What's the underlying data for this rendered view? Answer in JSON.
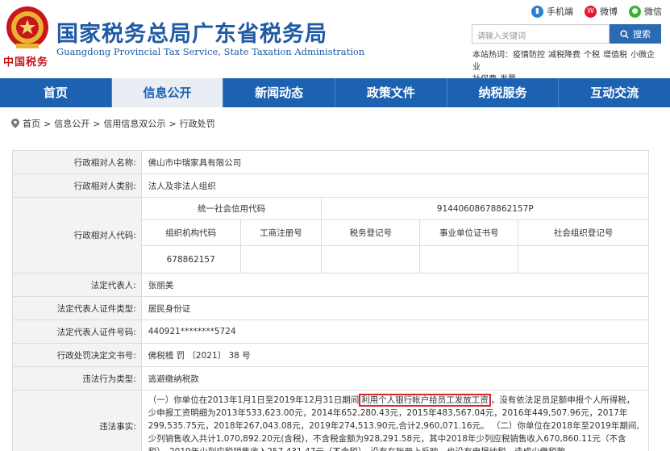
{
  "header": {
    "title": "国家税务总局广东省税务局",
    "subtitle": "Guangdong Provincial Tax Service, State Taxation Administration",
    "slogan": "中国税务",
    "toplinks": [
      {
        "label": "手机端",
        "icon": "mobile-icon",
        "color": "#2c7fd1"
      },
      {
        "label": "微博",
        "icon": "weibo-icon",
        "color": "#e6162d"
      },
      {
        "label": "微信",
        "icon": "wechat-icon",
        "color": "#3cb034"
      }
    ],
    "search": {
      "placeholder": "请输入关键词",
      "button": "搜索"
    },
    "hotwords_label": "本站热词：",
    "hotwords": [
      "疫情防控",
      "减税降费",
      "个税",
      "增值税",
      "小微企业",
      "社保费",
      "发票"
    ]
  },
  "nav": {
    "items": [
      "首页",
      "信息公开",
      "新闻动态",
      "政策文件",
      "纳税服务",
      "互动交流"
    ],
    "active_index": 1
  },
  "breadcrumb": [
    "首页",
    "信息公开",
    "信用信息双公示",
    "行政处罚"
  ],
  "record": {
    "name_label": "行政相对人名称:",
    "name": "佛山市中瑞家具有限公司",
    "category_label": "行政相对人类别:",
    "category": "法人及非法人组织",
    "code_label": "行政相对人代码:",
    "credit_code_header": "统一社会信用代码",
    "credit_code": "91440608678862157P",
    "sub_headers": [
      "组织机构代码",
      "工商注册号",
      "税务登记号",
      "事业单位证书号",
      "社会组织登记号"
    ],
    "sub_values": [
      "678862157",
      "",
      "",
      "",
      ""
    ],
    "legal_rep_label": "法定代表人:",
    "legal_rep": "张丽美",
    "id_type_label": "法定代表人证件类型:",
    "id_type": "居民身份证",
    "id_no_label": "法定代表人证件号码:",
    "id_no": "440921********5724",
    "decision_label": "行政处罚决定文书号:",
    "decision_no": "佛税稽 罚 〔2021〕 38 号",
    "violation_label": "违法行为类型:",
    "violation_type": "逃避缴纳税款",
    "facts_label": "违法事实:",
    "facts_p1_pre": "（一）你单位在2013年1月1日至2019年12月31日期间",
    "facts_p1_highlight": "利用个人银行帐户给员工发放工资",
    "facts_p1_post": "，没有依法足员足额申报个人所得税，少申报工资明细为2013年533,623.00元，2014年652,280.43元，2015年483,567.04元，2016年449,507.96元，2017年299,535.75元，2018年267,043.08元，2019年274,513.90元,合计2,960,071.16元。",
    "facts_p2": "（二）你单位在2018年至2019年期间,少列销售收入共计1,070,892.20元(含税)，不含税金额为928,291.58元，其中2018年少列应税销售收入670,860.11元（不含税），2019年少列应税销售收入257,431.47元（不含税），没有在账册上反映，也没有申报纳税，造成少缴税款。"
  }
}
